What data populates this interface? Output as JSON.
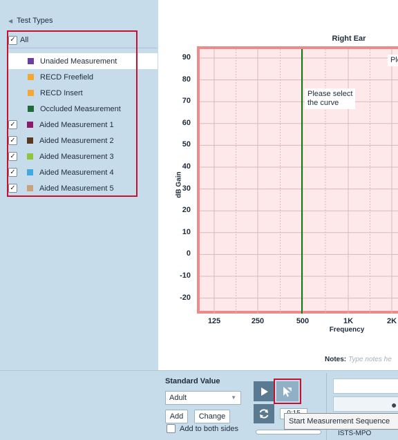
{
  "test_types": {
    "header": "Test Types",
    "all_label": "All",
    "all_checked": true,
    "items": [
      {
        "label": "Unaided Measurement",
        "color": "#6b3fa0",
        "checked": false,
        "selected": true
      },
      {
        "label": "RECD Freefield",
        "color": "#f4a733",
        "checked": false,
        "selected": false
      },
      {
        "label": "RECD Insert",
        "color": "#f4a733",
        "checked": false,
        "selected": false
      },
      {
        "label": "Occluded Measurement",
        "color": "#1f6b3a",
        "checked": false,
        "selected": false
      },
      {
        "label": "Aided Measurement 1",
        "color": "#8c1a6a",
        "checked": true,
        "selected": false
      },
      {
        "label": "Aided Measurement 2",
        "color": "#5a3a1e",
        "checked": true,
        "selected": false
      },
      {
        "label": "Aided Measurement 3",
        "color": "#8dc63f",
        "checked": true,
        "selected": false
      },
      {
        "label": "Aided Measurement 4",
        "color": "#3fa9e0",
        "checked": true,
        "selected": false
      },
      {
        "label": "Aided Measurement 5",
        "color": "#c8a27a",
        "checked": true,
        "selected": false
      }
    ]
  },
  "chart": {
    "title": "Right Ear",
    "ylabel": "dB Gain",
    "xlabel": "Frequency",
    "y_ticks": [
      "90",
      "80",
      "70",
      "60",
      "50",
      "40",
      "30",
      "20",
      "10",
      "0",
      "-10",
      "-20"
    ],
    "x_ticks": [
      "125",
      "250",
      "500",
      "1K",
      "2K"
    ],
    "hint_text_line1": "Please select",
    "hint_text_line2": "the curve",
    "hint_text_clipped": "Ple",
    "marker_color": "#0f7a0f"
  },
  "notes": {
    "label": "Notes:",
    "placeholder": "Type notes he"
  },
  "controls": {
    "standard_value_title": "Standard Value",
    "standard_value_selected": "Adult",
    "add_label": "Add",
    "change_label": "Change",
    "add_both_sides_label": "Add to both sides",
    "add_both_sides_checked": false,
    "time_value": "0:15",
    "tooltip_text": "Start Measurement Sequence",
    "signal_text": "ISTS-MPO",
    "play_icon": "play-icon",
    "sequence_icon": "cursor-sequence-icon",
    "reset_icon": "refresh-icon"
  }
}
